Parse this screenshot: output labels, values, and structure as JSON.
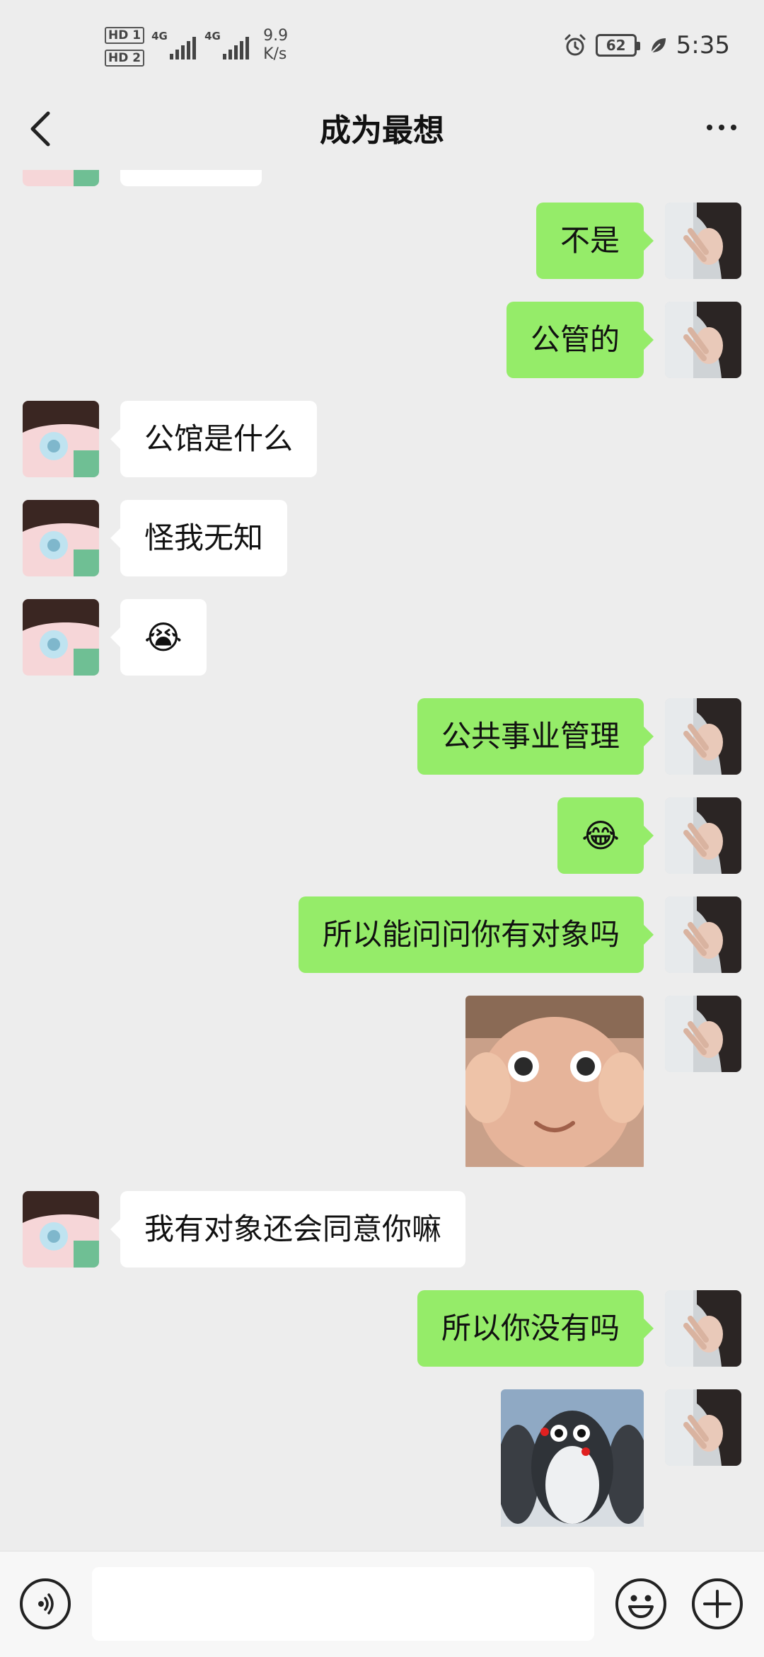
{
  "status_bar": {
    "hd1": "HD 1",
    "hd2": "HD 2",
    "network1": "4G",
    "network2": "4G",
    "speed_value": "9.9",
    "speed_unit": "K/s",
    "battery": "62",
    "time": "5:35"
  },
  "header": {
    "title": "成为最想",
    "back_icon": "chevron-left-icon",
    "more_icon": "more-dots-icon"
  },
  "messages": [
    {
      "side": "left",
      "type": "text",
      "text": "公馆是什么"
    },
    {
      "side": "left",
      "type": "text",
      "text": "怪我无知"
    },
    {
      "side": "left",
      "type": "emoji",
      "text": "😭"
    },
    {
      "side": "right",
      "type": "text",
      "text": "不是"
    },
    {
      "side": "right",
      "type": "text",
      "text": "公管的"
    },
    {
      "side": "right",
      "type": "text",
      "text": "公共事业管理"
    },
    {
      "side": "right",
      "type": "emoji",
      "text": "😂"
    },
    {
      "side": "right",
      "type": "text",
      "text": "所以能问问你有对象吗"
    },
    {
      "side": "right",
      "type": "sticker",
      "text": "baby-wide-eyes-sticker"
    },
    {
      "side": "left",
      "type": "text",
      "text": "我有对象还会同意你嘛"
    },
    {
      "side": "right",
      "type": "text",
      "text": "所以你没有吗"
    },
    {
      "side": "right",
      "type": "sticker",
      "text": "penguin-sticker"
    }
  ],
  "input_bar": {
    "voice_icon": "voice-icon",
    "emoji_icon": "emoji-icon",
    "plus_icon": "plus-icon",
    "input_value": ""
  },
  "colors": {
    "background": "#ededed",
    "sent_bubble": "#95ec69",
    "received_bubble": "#ffffff"
  }
}
